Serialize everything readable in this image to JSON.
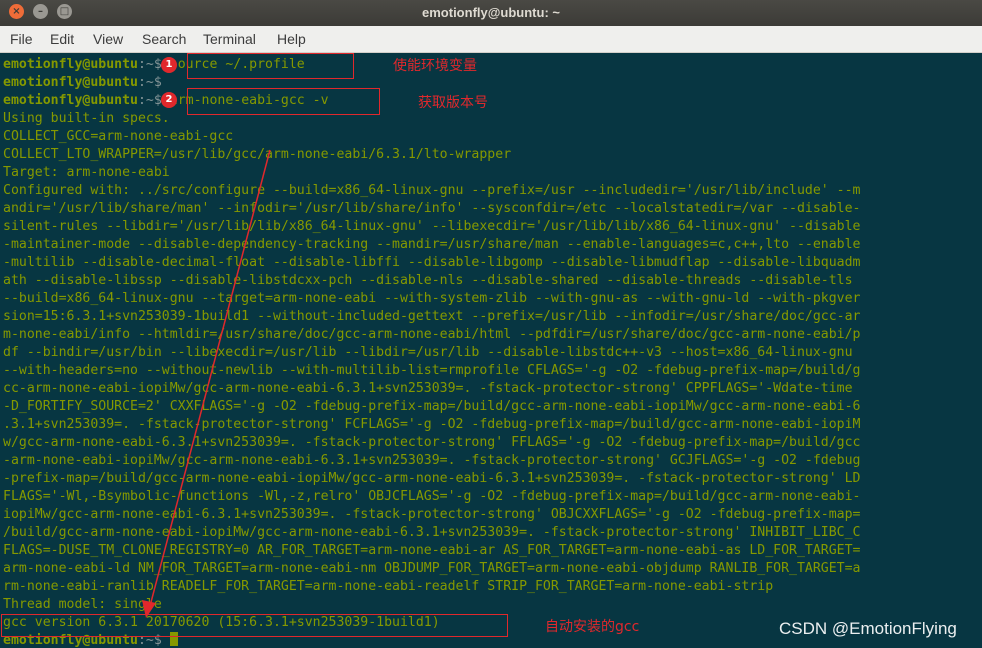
{
  "window": {
    "title": "emotionfly@ubuntu: ~",
    "close_glyph": "×",
    "min_glyph": "–",
    "max_glyph": "□"
  },
  "menu": {
    "file": "File",
    "edit": "Edit",
    "view": "View",
    "search": "Search",
    "terminal": "Terminal",
    "help": "Help"
  },
  "terminal": {
    "colors": {
      "background": "#073642",
      "foreground": "#859900",
      "annotation": "#e0282c"
    },
    "prompt_user": "emotionfly@ubuntu",
    "prompt_tail": ":~$",
    "commands": {
      "source": "source ~/.profile",
      "gcc_version": "arm-none-eabi-gcc -v"
    },
    "output": [
      "Using built-in specs.",
      "COLLECT_GCC=arm-none-eabi-gcc",
      "COLLECT_LTO_WRAPPER=/usr/lib/gcc/arm-none-eabi/6.3.1/lto-wrapper",
      "Target: arm-none-eabi",
      "Configured with: ../src/configure --build=x86_64-linux-gnu --prefix=/usr --includedir='/usr/lib/include' --m",
      "andir='/usr/lib/share/man' --infodir='/usr/lib/share/info' --sysconfdir=/etc --localstatedir=/var --disable-",
      "silent-rules --libdir='/usr/lib/lib/x86_64-linux-gnu' --libexecdir='/usr/lib/lib/x86_64-linux-gnu' --disable",
      "-maintainer-mode --disable-dependency-tracking --mandir=/usr/share/man --enable-languages=c,c++,lto --enable",
      "-multilib --disable-decimal-float --disable-libffi --disable-libgomp --disable-libmudflap --disable-libquadm",
      "ath --disable-libssp --disable-libstdcxx-pch --disable-nls --disable-shared --disable-threads --disable-tls",
      "--build=x86_64-linux-gnu --target=arm-none-eabi --with-system-zlib --with-gnu-as --with-gnu-ld --with-pkgver",
      "sion=15:6.3.1+svn253039-1build1 --without-included-gettext --prefix=/usr/lib --infodir=/usr/share/doc/gcc-ar",
      "m-none-eabi/info --htmldir=/usr/share/doc/gcc-arm-none-eabi/html --pdfdir=/usr/share/doc/gcc-arm-none-eabi/p",
      "df --bindir=/usr/bin --libexecdir=/usr/lib --libdir=/usr/lib --disable-libstdc++-v3 --host=x86_64-linux-gnu",
      "--with-headers=no --without-newlib --with-multilib-list=rmprofile CFLAGS='-g -O2 -fdebug-prefix-map=/build/g",
      "cc-arm-none-eabi-iopiMw/gcc-arm-none-eabi-6.3.1+svn253039=. -fstack-protector-strong' CPPFLAGS='-Wdate-time",
      "-D_FORTIFY_SOURCE=2' CXXFLAGS='-g -O2 -fdebug-prefix-map=/build/gcc-arm-none-eabi-iopiMw/gcc-arm-none-eabi-6",
      ".3.1+svn253039=. -fstack-protector-strong' FCFLAGS='-g -O2 -fdebug-prefix-map=/build/gcc-arm-none-eabi-iopiM",
      "w/gcc-arm-none-eabi-6.3.1+svn253039=. -fstack-protector-strong' FFLAGS='-g -O2 -fdebug-prefix-map=/build/gcc",
      "-arm-none-eabi-iopiMw/gcc-arm-none-eabi-6.3.1+svn253039=. -fstack-protector-strong' GCJFLAGS='-g -O2 -fdebug",
      "-prefix-map=/build/gcc-arm-none-eabi-iopiMw/gcc-arm-none-eabi-6.3.1+svn253039=. -fstack-protector-strong' LD",
      "FLAGS='-Wl,-Bsymbolic-functions -Wl,-z,relro' OBJCFLAGS='-g -O2 -fdebug-prefix-map=/build/gcc-arm-none-eabi-",
      "iopiMw/gcc-arm-none-eabi-6.3.1+svn253039=. -fstack-protector-strong' OBJCXXFLAGS='-g -O2 -fdebug-prefix-map=",
      "/build/gcc-arm-none-eabi-iopiMw/gcc-arm-none-eabi-6.3.1+svn253039=. -fstack-protector-strong' INHIBIT_LIBC_C",
      "FLAGS=-DUSE_TM_CLONE_REGISTRY=0 AR_FOR_TARGET=arm-none-eabi-ar AS_FOR_TARGET=arm-none-eabi-as LD_FOR_TARGET=",
      "arm-none-eabi-ld NM_FOR_TARGET=arm-none-eabi-nm OBJDUMP_FOR_TARGET=arm-none-eabi-objdump RANLIB_FOR_TARGET=a",
      "rm-none-eabi-ranlib READELF_FOR_TARGET=arm-none-eabi-readelf STRIP_FOR_TARGET=arm-none-eabi-strip",
      "Thread model: single",
      "gcc version 6.3.1 20170620 (15:6.3.1+svn253039-1build1)"
    ]
  },
  "annotations": {
    "badge1": "1",
    "badge2": "2",
    "label1": "使能环境变量",
    "label2": "获取版本号",
    "label3": "自动安装的gcc"
  },
  "watermark": "CSDN @EmotionFlying"
}
